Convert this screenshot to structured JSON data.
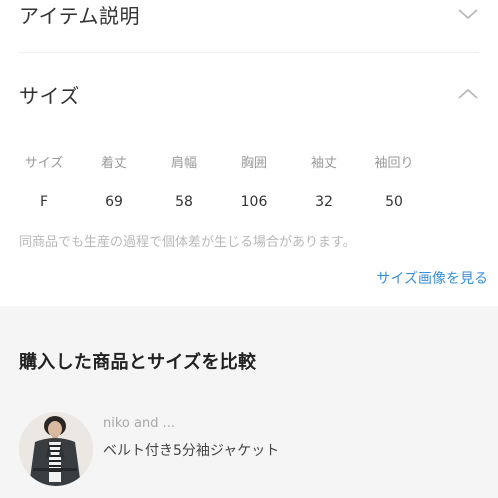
{
  "item_section": {
    "title": "アイテム説明",
    "icon": "chevron-down-icon",
    "expanded": false
  },
  "size_section": {
    "title": "サイズ",
    "icon": "chevron-up-icon",
    "expanded": true,
    "table": {
      "headers": [
        "サイズ",
        "着丈",
        "肩幅",
        "胸囲",
        "袖丈",
        "袖回り"
      ],
      "rows": [
        [
          "F",
          "69",
          "58",
          "106",
          "32",
          "50"
        ]
      ]
    },
    "disclaimer": "同商品でも生産の過程で個体差が生じる場合があります。",
    "size_image_link": "サイズ画像を見る"
  },
  "compare_section": {
    "title": "購入した商品とサイズを比較",
    "product": {
      "brand": "niko and ...",
      "name": "ベルト付き5分袖ジャケット"
    }
  },
  "colors": {
    "link": "#3a8fd8",
    "muted_text": "#9a9a9a",
    "section_bg": "#f5f5f5"
  }
}
